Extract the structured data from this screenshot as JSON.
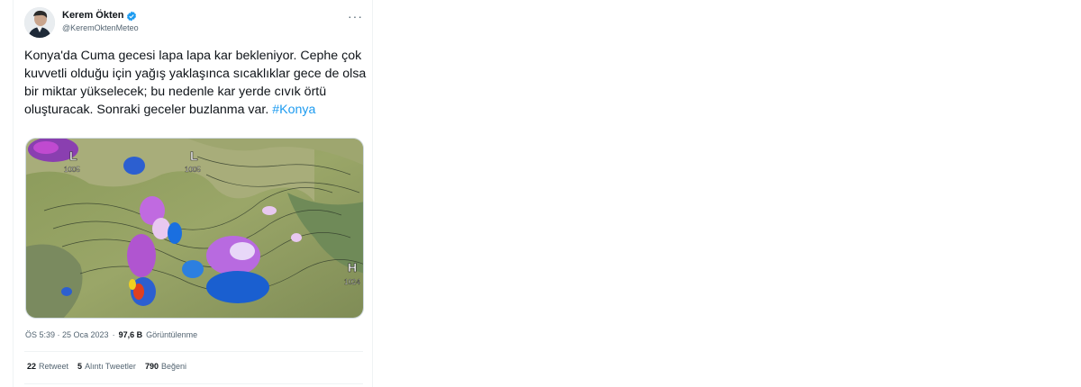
{
  "tweet": {
    "author_name": "Kerem Ökten",
    "author_handle": "@KeremOktenMeteo",
    "text_main": "Konya'da Cuma gecesi lapa lapa kar bekleniyor. Cephe çok kuvvetli olduğu için yağış yaklaşınca sıcaklıklar gece de olsa bir miktar yükselecek; bu nedenle kar yerde cıvık örtü oluşturacak. Sonraki geceler buzlanma var. ",
    "hashtag": "#Konya",
    "time": "ÖS 5:39 · 25 Oca 2023",
    "separator": "·",
    "views_count": "97,6 B",
    "views_label": "Görüntülenme",
    "retweets_count": "22",
    "retweets_label": "Retweet",
    "quotes_count": "5",
    "quotes_label": "Alıntı Tweetler",
    "likes_count": "790",
    "likes_label": "Beğeni",
    "more_icon": "more-dots-icon",
    "verified_icon": "verified-badge-icon"
  },
  "map": {
    "low1_letter": "L",
    "low1_value": "1005",
    "low2_letter": "L",
    "low2_value": "1005",
    "high_letter": "H",
    "high_value": "1024"
  },
  "colors": {
    "accent": "#1d9bf0",
    "text": "#0f1419",
    "muted": "#536471"
  }
}
